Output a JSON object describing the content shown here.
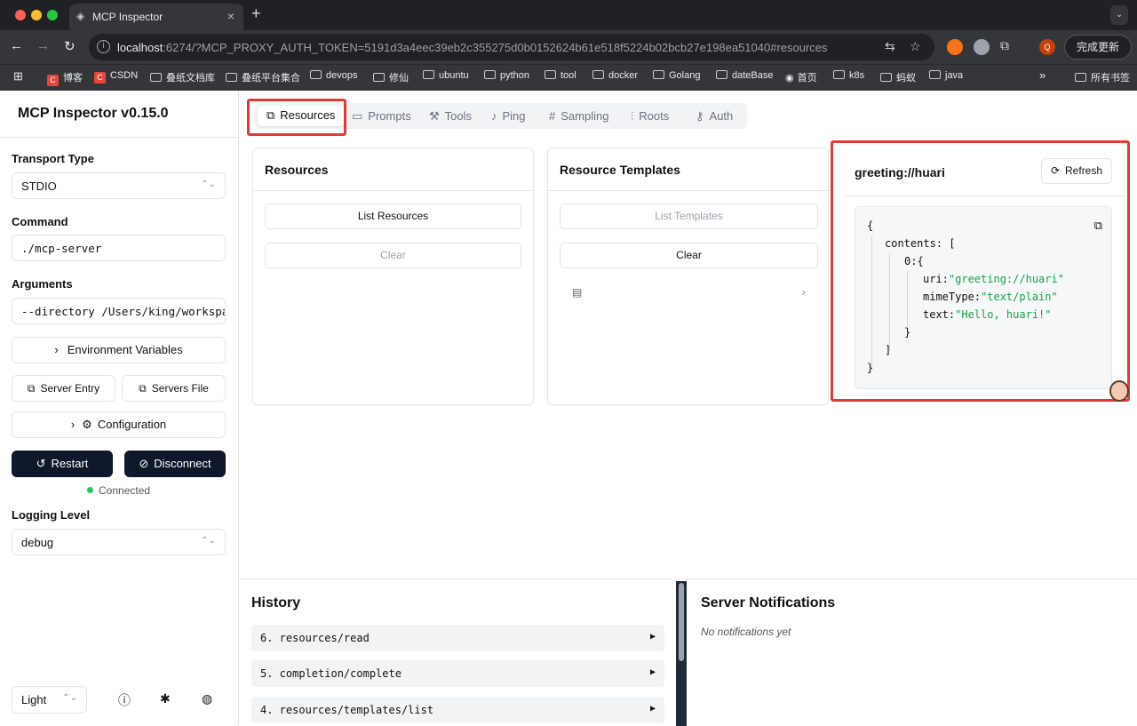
{
  "browser": {
    "tab_title": "MCP Inspector",
    "url_host": "localhost",
    "url_rest": ":6274/?MCP_PROXY_AUTH_TOKEN=5191d3a4eec39eb2c355275d0b0152624b61e518f5224b02bcb27e198ea51040#resources",
    "update_button": "完成更新",
    "bookmarks": [
      "博客",
      "CSDN",
      "叠纸文档库",
      "叠纸平台集合",
      "devops",
      "修仙",
      "ubuntu",
      "python",
      "tool",
      "docker",
      "Golang",
      "dateBase",
      "首页",
      "k8s",
      "蚂蚁",
      "java"
    ],
    "all_bookmarks": "所有书签",
    "more": "»"
  },
  "sidebar": {
    "title": "MCP Inspector v0.15.0",
    "transport_label": "Transport Type",
    "transport_value": "STDIO",
    "command_label": "Command",
    "command_value": "./mcp-server",
    "arguments_label": "Arguments",
    "arguments_value": "--directory /Users/king/workspa",
    "env_vars": "Environment Variables",
    "server_entry": "Server Entry",
    "servers_file": "Servers File",
    "configuration": "Configuration",
    "restart": "Restart",
    "disconnect": "Disconnect",
    "status": "Connected",
    "logging_label": "Logging Level",
    "logging_value": "debug",
    "theme_value": "Light"
  },
  "tabs": [
    "Resources",
    "Prompts",
    "Tools",
    "Ping",
    "Sampling",
    "Roots",
    "Auth"
  ],
  "resources_card": {
    "title": "Resources",
    "list_button": "List Resources",
    "clear_button": "Clear"
  },
  "templates_card": {
    "title": "Resource Templates",
    "list_button": "List Templates",
    "clear_button": "Clear"
  },
  "detail_card": {
    "title": "greeting://huari",
    "refresh_button": "Refresh",
    "json": {
      "open": "{",
      "contents_key": "contents:",
      "bracket_open": "[",
      "index_key": "0:",
      "inner_open": "{",
      "uri_key": "uri:",
      "uri_val": "\"greeting://huari\"",
      "mime_key": "mimeType:",
      "mime_val": "\"text/plain\"",
      "text_key": "text:",
      "text_val": "\"Hello, huari!\"",
      "inner_close": "}",
      "bracket_close": "]",
      "close": "}"
    }
  },
  "history": {
    "title": "History",
    "items": [
      "6. resources/read",
      "5. completion/complete",
      "4. resources/templates/list"
    ],
    "expand": "▶"
  },
  "notifications": {
    "title": "Server Notifications",
    "empty": "No notifications yet"
  }
}
